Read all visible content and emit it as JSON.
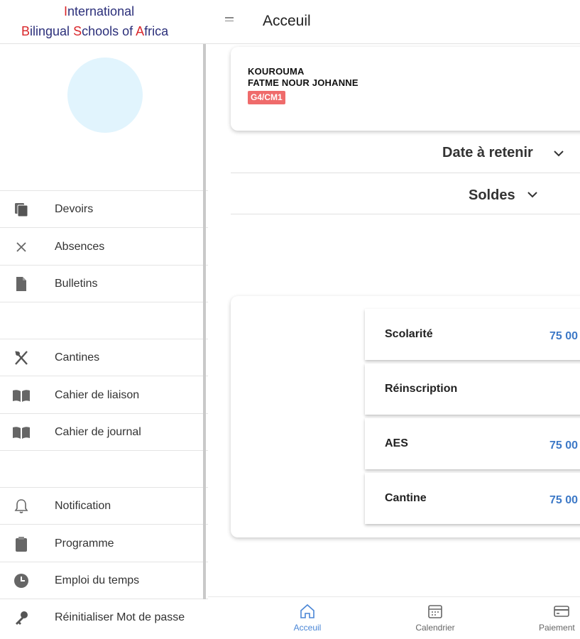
{
  "brand": {
    "line1_first": "I",
    "line1_rest": "nternational",
    "line2_b": "B",
    "line2_a": "ilingual ",
    "line2_s": "S",
    "line2_b2": "chools of ",
    "line2_af": "A",
    "line2_end": "frica",
    "colors": {
      "navy": "#2b2f7a",
      "red": "#d9262a"
    }
  },
  "header": {
    "title": "Acceuil",
    "menu_icon": "hamburger-icon"
  },
  "sidebar": {
    "items": [
      {
        "label": "Devoirs",
        "icon": "copy-icon"
      },
      {
        "label": "Absences",
        "icon": "close-icon"
      },
      {
        "label": "Bulletins",
        "icon": "document-icon"
      },
      {
        "label": "Cantines",
        "icon": "utensils-icon"
      },
      {
        "label": "Cahier de liaison",
        "icon": "book-icon"
      },
      {
        "label": "Cahier de journal",
        "icon": "book-icon"
      },
      {
        "label": "Notification",
        "icon": "bell-icon"
      },
      {
        "label": "Programme",
        "icon": "clipboard-icon"
      },
      {
        "label": "Emploi du temps",
        "icon": "clock-icon"
      },
      {
        "label": "Réinitialiser Mot de passe",
        "icon": "key-icon"
      }
    ]
  },
  "student": {
    "last_name": "KOUROUMA",
    "first_names": "FATME NOUR JOHANNE",
    "class": "G4/CM1",
    "badge_color": "#ef6b6b"
  },
  "accordions": [
    {
      "title": "Date à retenir",
      "icon": "chevron-down-icon"
    },
    {
      "title": "Soldes",
      "icon": "chevron-down-icon"
    }
  ],
  "soldes": [
    {
      "label": "Scolarité",
      "amount": "75 00"
    },
    {
      "label": "Réinscription",
      "amount": ""
    },
    {
      "label": "AES",
      "amount": "75 00"
    },
    {
      "label": "Cantine",
      "amount": "75 00"
    }
  ],
  "bottom_nav": [
    {
      "label": "Acceuil",
      "icon": "home-icon",
      "active": true
    },
    {
      "label": "Calendrier",
      "icon": "calendar-icon",
      "active": false
    },
    {
      "label": "Paiement",
      "icon": "card-icon",
      "active": false
    }
  ],
  "accent_color": "#4a86d6"
}
